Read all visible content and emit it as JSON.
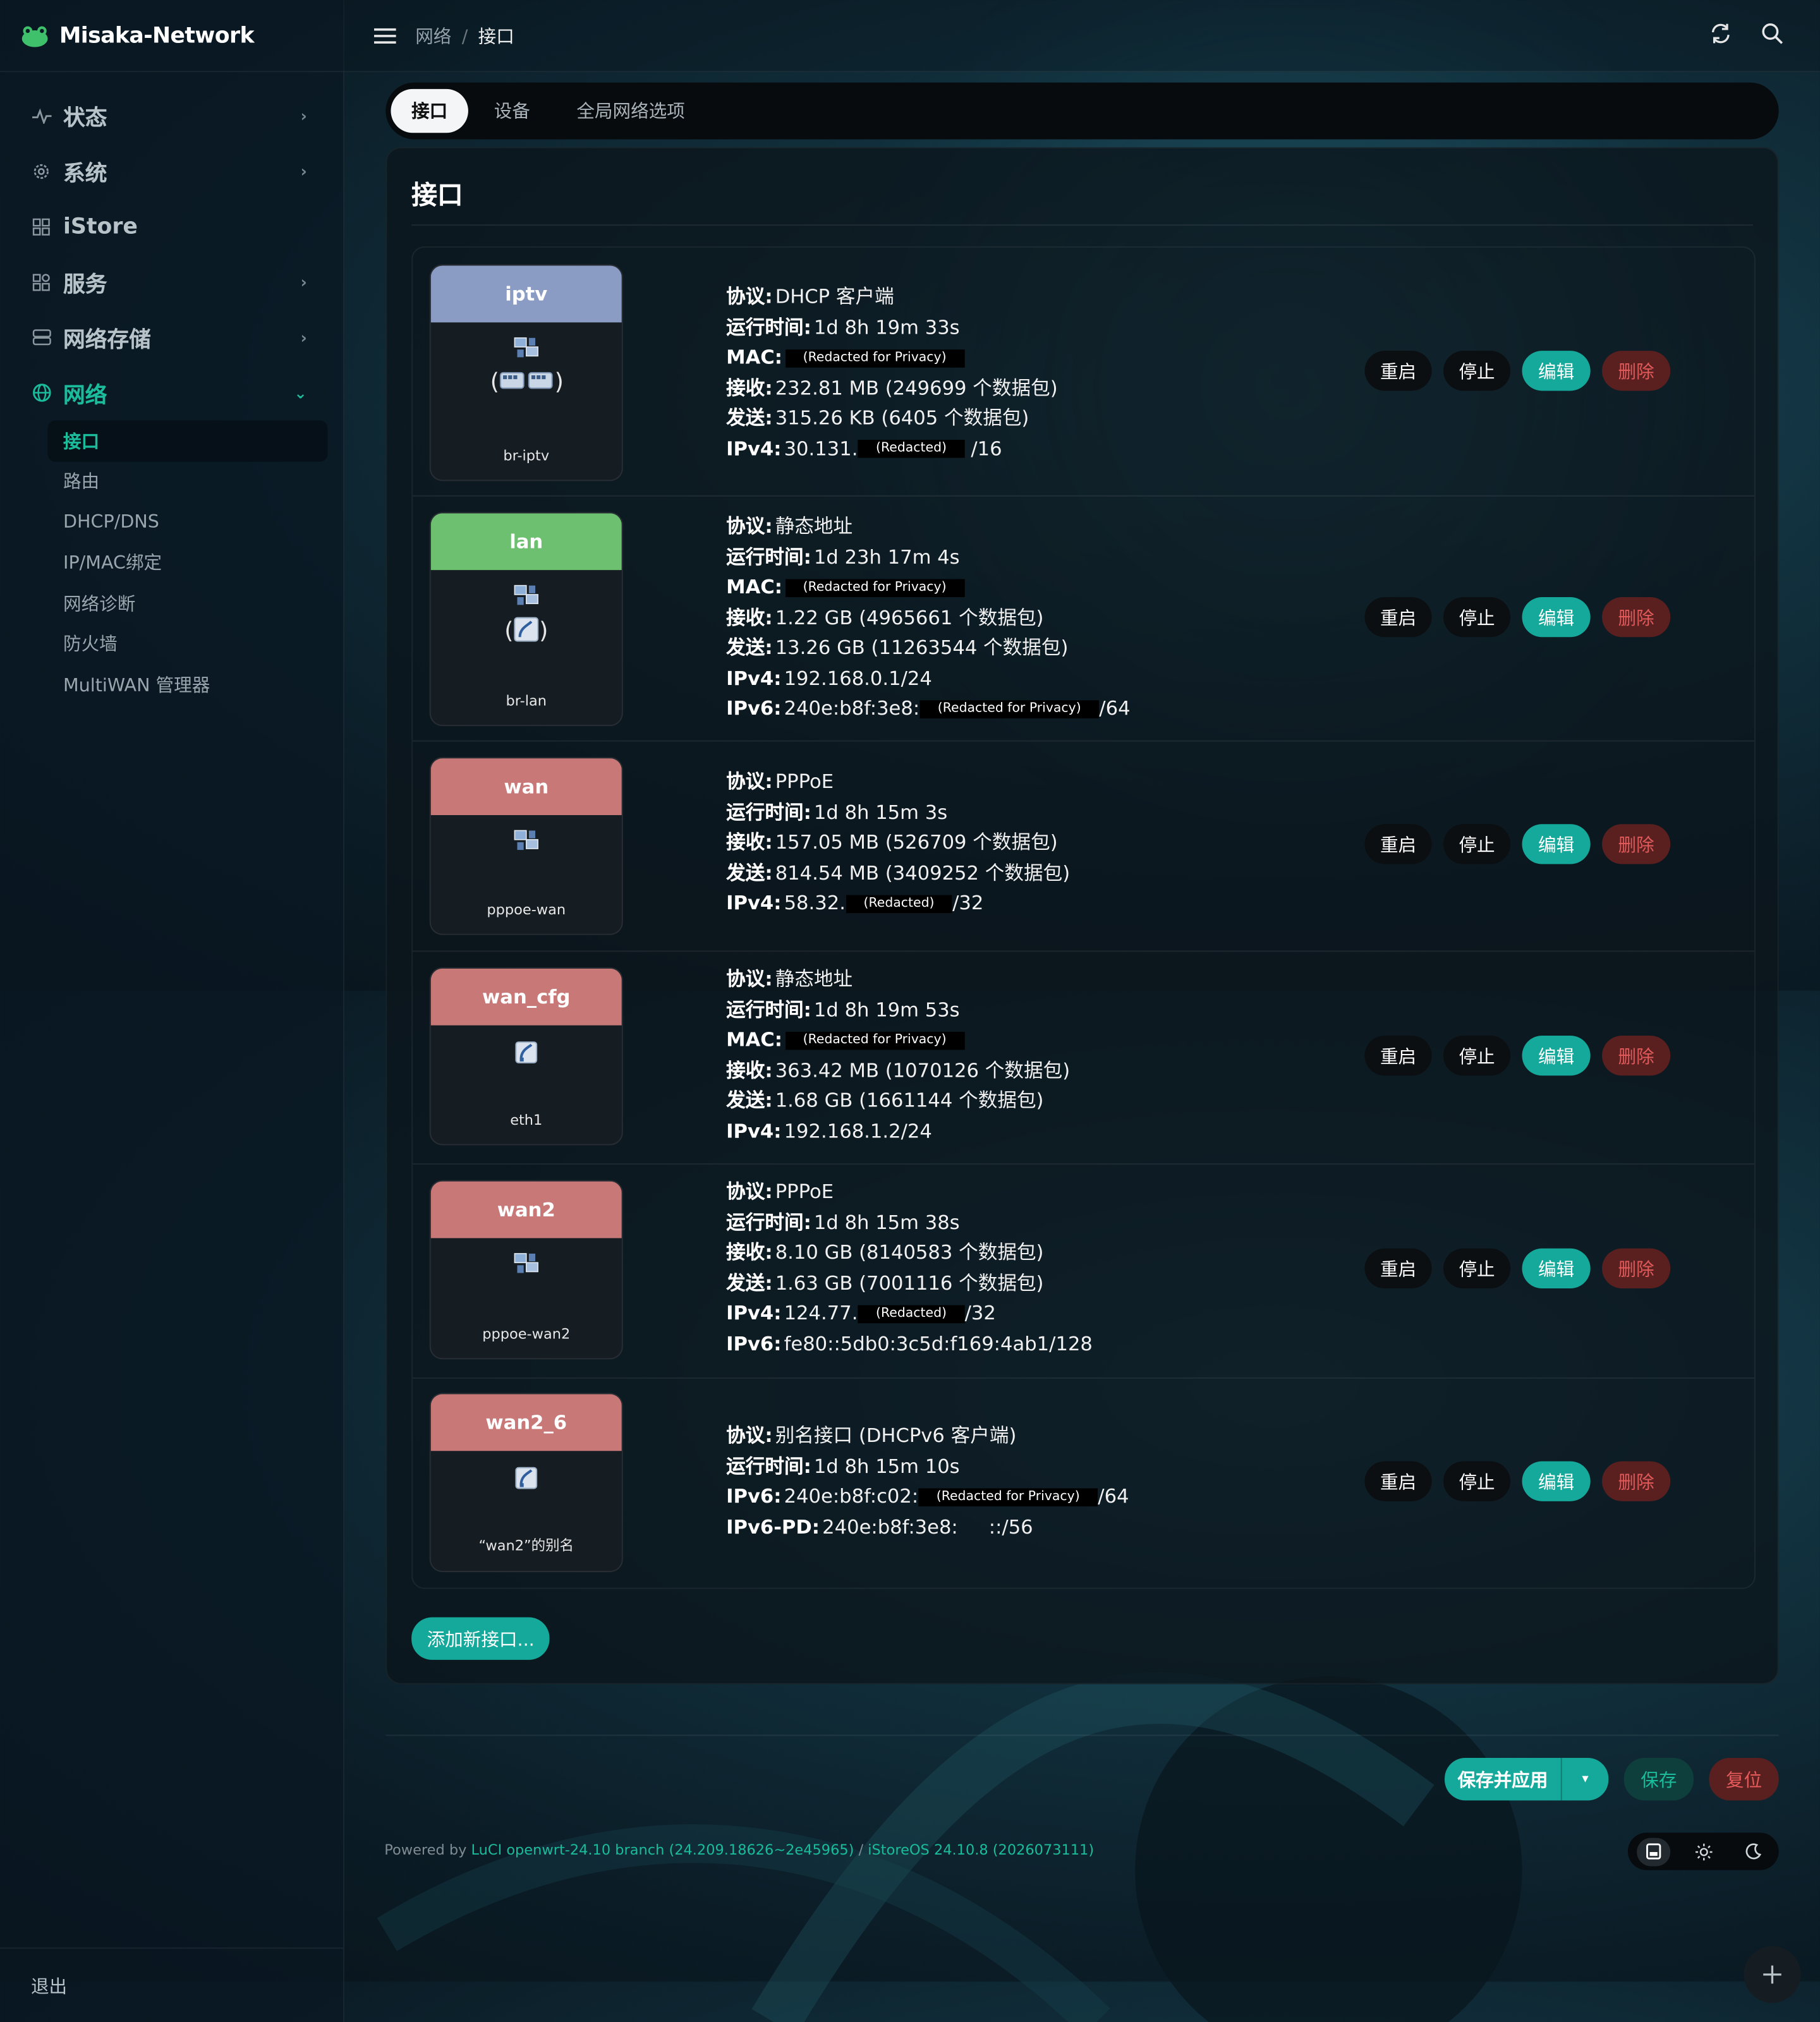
{
  "brand": {
    "name": "Misaka-Network"
  },
  "sidebar": {
    "menu": [
      {
        "label": "状态",
        "icon": "activity-icon"
      },
      {
        "label": "系统",
        "icon": "gear-icon"
      },
      {
        "label": "iStore",
        "icon": "grid-icon"
      },
      {
        "label": "服务",
        "icon": "apps-icon"
      },
      {
        "label": "网络存储",
        "icon": "storage-icon"
      },
      {
        "label": "网络",
        "icon": "globe-icon"
      }
    ],
    "network_sub": [
      "接口",
      "路由",
      "DHCP/DNS",
      "IP/MAC绑定",
      "网络诊断",
      "防火墙",
      "MultiWAN 管理器"
    ],
    "logout": "退出"
  },
  "breadcrumb": {
    "parent": "网络",
    "sep": "/",
    "current": "接口"
  },
  "tabs": [
    "接口",
    "设备",
    "全局网络选项"
  ],
  "card_title": "接口",
  "interfaces": [
    {
      "name": "iptv",
      "device": "br-iptv",
      "color": "#8b9cc4",
      "lines": [
        {
          "label": "协议:",
          "value": "DHCP 客户端"
        },
        {
          "label": "运行时间:",
          "value": "1d 8h 19m 33s"
        },
        {
          "label": "MAC:",
          "value": "",
          "redact": "(Redacted for Privacy)"
        },
        {
          "label": "接收:",
          "value": "232.81 MB (249699 个数据包)"
        },
        {
          "label": "发送:",
          "value": "315.26 KB (6405 个数据包)"
        },
        {
          "label": "IPv4:",
          "value": "30.131.",
          "redact": "(Redacted)",
          "suffix": " /16"
        }
      ]
    },
    {
      "name": "lan",
      "device": "br-lan",
      "color": "#6cc070",
      "lines": [
        {
          "label": "协议:",
          "value": "静态地址"
        },
        {
          "label": "运行时间:",
          "value": "1d 23h 17m 4s"
        },
        {
          "label": "MAC:",
          "value": "",
          "redact": "(Redacted for Privacy)"
        },
        {
          "label": "接收:",
          "value": "1.22 GB (4965661 个数据包)"
        },
        {
          "label": "发送:",
          "value": "13.26 GB (11263544 个数据包)"
        },
        {
          "label": "IPv4:",
          "value": "192.168.0.1/24"
        },
        {
          "label": "IPv6:",
          "value": "240e:b8f:3e8:",
          "redact": "(Redacted for Privacy)",
          "suffix": "/64"
        }
      ]
    },
    {
      "name": "wan",
      "device": "pppoe-wan",
      "color": "#c97878",
      "lines": [
        {
          "label": "协议:",
          "value": "PPPoE"
        },
        {
          "label": "运行时间:",
          "value": "1d 8h 15m 3s"
        },
        {
          "label": "接收:",
          "value": "157.05 MB (526709 个数据包)"
        },
        {
          "label": "发送:",
          "value": "814.54 MB (3409252 个数据包)"
        },
        {
          "label": "IPv4:",
          "value": "58.32.",
          "redact": "(Redacted)",
          "suffix": "/32"
        }
      ]
    },
    {
      "name": "wan_cfg",
      "device": "eth1",
      "color": "#c97878",
      "lines": [
        {
          "label": "协议:",
          "value": "静态地址"
        },
        {
          "label": "运行时间:",
          "value": "1d 8h 19m 53s"
        },
        {
          "label": "MAC:",
          "value": "",
          "redact": "(Redacted for Privacy)"
        },
        {
          "label": "接收:",
          "value": "363.42 MB (1070126 个数据包)"
        },
        {
          "label": "发送:",
          "value": "1.68 GB (1661144 个数据包)"
        },
        {
          "label": "IPv4:",
          "value": "192.168.1.2/24"
        }
      ]
    },
    {
      "name": "wan2",
      "device": "pppoe-wan2",
      "color": "#c97878",
      "lines": [
        {
          "label": "协议:",
          "value": "PPPoE"
        },
        {
          "label": "运行时间:",
          "value": "1d 8h 15m 38s"
        },
        {
          "label": "接收:",
          "value": "8.10 GB (8140583 个数据包)"
        },
        {
          "label": "发送:",
          "value": "1.63 GB (7001116 个数据包)"
        },
        {
          "label": "IPv4:",
          "value": "124.77.",
          "redact": "(Redacted)",
          "suffix": "/32"
        },
        {
          "label": "IPv6:",
          "value": "fe80::5db0:3c5d:f169:4ab1/128"
        }
      ]
    },
    {
      "name": "wan2_6",
      "device": "“wan2”的别名",
      "color": "#c97878",
      "lines": [
        {
          "label": "协议:",
          "value": "别名接口 (DHCPv6 客户端)"
        },
        {
          "label": "运行时间:",
          "value": "1d 8h 15m 10s"
        },
        {
          "label": "IPv6:",
          "value": "240e:b8f:c02:",
          "redact": "(Redacted for Privacy)",
          "suffix": "/64"
        },
        {
          "label": "IPv6-PD:",
          "value": "240e:b8f:3e8:",
          "redact": " ",
          "suffix": "::/56"
        }
      ]
    }
  ],
  "row_buttons": {
    "restart": "重启",
    "stop": "停止",
    "edit": "编辑",
    "delete": "删除"
  },
  "add_button": "添加新接口...",
  "actions": {
    "save_apply": "保存并应用",
    "caret": "▾",
    "save": "保存",
    "reset": "复位"
  },
  "footer": {
    "powered_prefix": "Powered by",
    "luci": "LuCI openwrt-24.10 branch (24.209.18626~2e45965)",
    "slash": "/",
    "os": "iStoreOS 24.10.8 (2026073111)"
  },
  "colors": {
    "accent": "#1abc9c",
    "danger": "#e05a5a"
  }
}
